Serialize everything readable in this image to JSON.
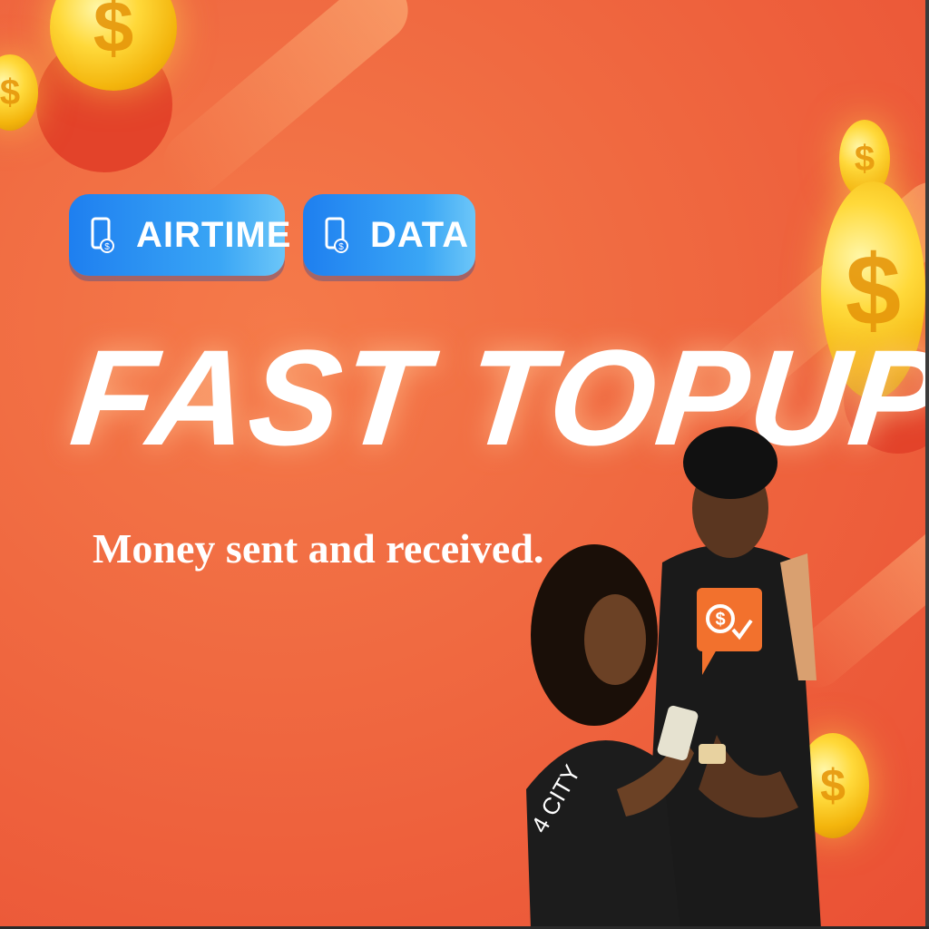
{
  "banner": {
    "pills": [
      {
        "label": "AIRTIME",
        "icon": "phone-dollar-icon"
      },
      {
        "label": "DATA",
        "icon": "phone-dollar-icon"
      }
    ],
    "headline": "FAST TOPUP",
    "tagline": "Money sent and received.",
    "coin_symbol": "$",
    "bubble_icon": "dollar-check-icon",
    "colors": {
      "background": "#f06a41",
      "pill": "#1e7ff0",
      "coin": "#ffd93a",
      "bubble": "#f2712d",
      "text": "#ffffff"
    }
  }
}
